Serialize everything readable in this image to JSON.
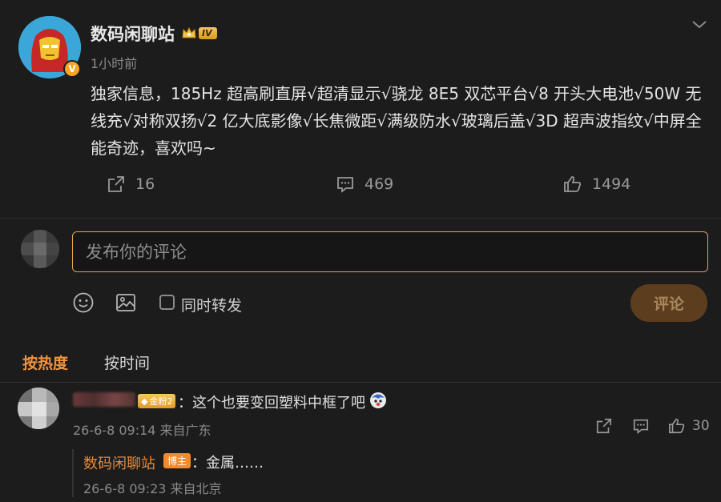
{
  "post": {
    "author": "数码闲聊站",
    "level": "IV",
    "verified_mark": "V",
    "time": "1小时前",
    "text": "独家信息，185Hz 超高刷直屏√超清显示√骁龙 8E5 双芯平台√8 开头大电池√50W 无线充√对称双扬√2 亿大底影像√长焦微距√满级防水√玻璃后盖√3D 超声波指纹√中屏全能奇迹，喜欢吗~",
    "actions": {
      "repost_count": "16",
      "comment_count": "469",
      "like_count": "1494"
    }
  },
  "composer": {
    "placeholder": "发布你的评论",
    "repost_label": "同时转发",
    "submit_label": "评论"
  },
  "sort_tabs": {
    "hot": "按热度",
    "time": "按时间"
  },
  "comments": [
    {
      "fan_badge": "金粉2",
      "text": "：这个也要变回塑料中框了吧",
      "meta": "26-6-8 09:14 来自广东",
      "like_count": "30",
      "replies": [
        {
          "author": "数码闲聊站",
          "badge": "博主",
          "text": "：金属……",
          "meta": "26-6-8 09:23 来自北京"
        }
      ]
    }
  ],
  "icons": {
    "more": "chevron-down-icon",
    "repost": "share-icon",
    "comment": "comment-icon",
    "like": "thumbs-up-icon",
    "emoji": "smiley-icon",
    "image": "image-icon"
  },
  "colors": {
    "background": "#1c1c1c",
    "accent": "#f1923e",
    "input_border": "#e7a24b",
    "submit_bg": "#5c3e1e"
  }
}
